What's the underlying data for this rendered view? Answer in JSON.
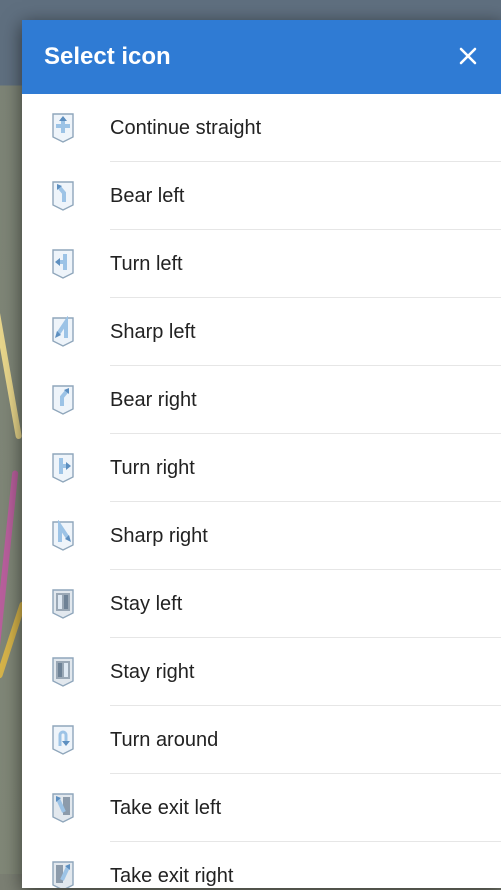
{
  "dialog": {
    "title": "Select icon",
    "close_icon": "close-icon",
    "header_color": "#2f7bd4"
  },
  "items": [
    {
      "label": "Continue straight",
      "icon": "continue-straight-icon"
    },
    {
      "label": "Bear left",
      "icon": "bear-left-icon"
    },
    {
      "label": "Turn left",
      "icon": "turn-left-icon"
    },
    {
      "label": "Sharp left",
      "icon": "sharp-left-icon"
    },
    {
      "label": "Bear right",
      "icon": "bear-right-icon"
    },
    {
      "label": "Turn right",
      "icon": "turn-right-icon"
    },
    {
      "label": "Sharp right",
      "icon": "sharp-right-icon"
    },
    {
      "label": "Stay left",
      "icon": "stay-left-icon"
    },
    {
      "label": "Stay right",
      "icon": "stay-right-icon"
    },
    {
      "label": "Turn around",
      "icon": "turn-around-icon"
    },
    {
      "label": "Take exit left",
      "icon": "take-exit-left-icon"
    },
    {
      "label": "Take exit right",
      "icon": "take-exit-right-icon"
    }
  ]
}
